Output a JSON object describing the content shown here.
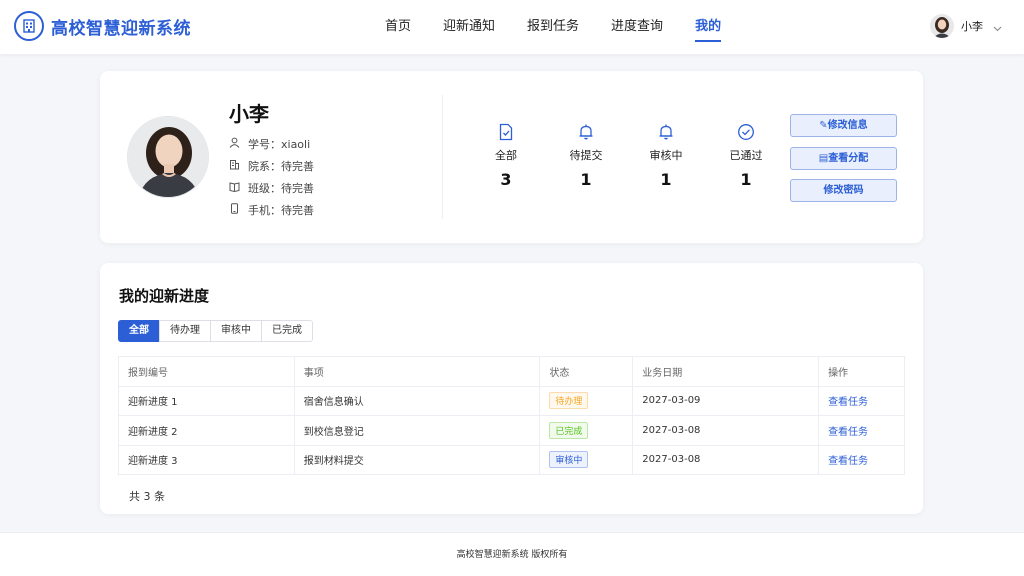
{
  "app": {
    "title": "高校智慧迎新系统"
  },
  "nav": [
    {
      "label": "首页",
      "active": false
    },
    {
      "label": "迎新通知",
      "active": false
    },
    {
      "label": "报到任务",
      "active": false
    },
    {
      "label": "进度查询",
      "active": false
    },
    {
      "label": "我的",
      "active": true
    }
  ],
  "user": {
    "name": "小李"
  },
  "profile": {
    "name": "小李",
    "fields": [
      {
        "icon": "user-icon",
        "label": "学号：xiaoli"
      },
      {
        "icon": "building-icon",
        "label": "院系：待完善"
      },
      {
        "icon": "book-icon",
        "label": "班级：待完善"
      },
      {
        "icon": "phone-icon",
        "label": "手机：待完善"
      }
    ]
  },
  "stats": [
    {
      "icon": "document-check-icon",
      "label": "全部",
      "value": "3"
    },
    {
      "icon": "bell-icon",
      "label": "待提交",
      "value": "1"
    },
    {
      "icon": "bell-icon",
      "label": "审核中",
      "value": "1"
    },
    {
      "icon": "check-circle-icon",
      "label": "已通过",
      "value": "1"
    }
  ],
  "actions": {
    "edit_info": "✎修改信息",
    "view_assign": "▤查看分配",
    "change_password": "修改密码"
  },
  "progress": {
    "title": "我的迎新进度",
    "tabs": [
      {
        "label": "全部",
        "active": true
      },
      {
        "label": "待办理",
        "active": false
      },
      {
        "label": "审核中",
        "active": false
      },
      {
        "label": "已完成",
        "active": false
      }
    ],
    "columns": [
      "报到编号",
      "事项",
      "状态",
      "业务日期",
      "操作"
    ],
    "rows": [
      {
        "id": "迎新进度 1",
        "item": "宿舍信息确认",
        "status": "待办理",
        "status_color": "#f5a623",
        "date": "2027-03-09",
        "action": "查看任务"
      },
      {
        "id": "迎新进度 2",
        "item": "到校信息登记",
        "status": "已完成",
        "status_color": "#52c41a",
        "date": "2027-03-08",
        "action": "查看任务"
      },
      {
        "id": "迎新进度 3",
        "item": "报到材料提交",
        "status": "审核中",
        "status_color": "#2c5fd6",
        "date": "2027-03-08",
        "action": "查看任务"
      }
    ],
    "total": "共 3 条"
  },
  "footer": {
    "text": "高校智慧迎新系统 版权所有"
  },
  "colors": {
    "accent": "#2c5fd6",
    "background": "#f4f6f9"
  }
}
